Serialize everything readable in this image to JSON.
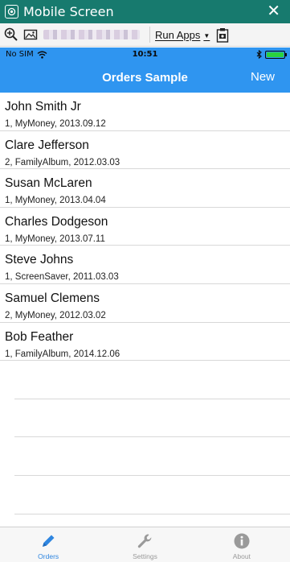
{
  "window": {
    "title": "Mobile Screen",
    "close_glyph": "✕"
  },
  "toolbar": {
    "run_apps_label": "Run Apps",
    "run_apps_arrow": "▼"
  },
  "status_bar": {
    "carrier": "No SIM",
    "time": "10:51"
  },
  "nav": {
    "title": "Orders Sample",
    "new_label": "New"
  },
  "orders": [
    {
      "name": "John Smith Jr",
      "detail": "1, MyMoney, 2013.09.12"
    },
    {
      "name": "Clare Jefferson",
      "detail": "2, FamilyAlbum, 2012.03.03"
    },
    {
      "name": "Susan McLaren",
      "detail": "1, MyMoney, 2013.04.04"
    },
    {
      "name": "Charles Dodgeson",
      "detail": "1, MyMoney, 2013.07.11"
    },
    {
      "name": "Steve Johns",
      "detail": "1, ScreenSaver, 2011.03.03"
    },
    {
      "name": "Samuel Clemens",
      "detail": "2, MyMoney, 2012.03.02"
    },
    {
      "name": "Bob Feather",
      "detail": "1, FamilyAlbum, 2014.12.06"
    }
  ],
  "tabs": [
    {
      "label": "Orders",
      "icon": "pencil-icon",
      "active": true
    },
    {
      "label": "Settings",
      "icon": "wrench-icon",
      "active": false
    },
    {
      "label": "About",
      "icon": "info-icon",
      "active": false
    }
  ],
  "colors": {
    "window_titlebar": "#177a6e",
    "ios_blue": "#2f95f0",
    "tab_active": "#2f86e0",
    "tab_inactive": "#9a9a9a",
    "battery_green": "#2bd13e"
  }
}
